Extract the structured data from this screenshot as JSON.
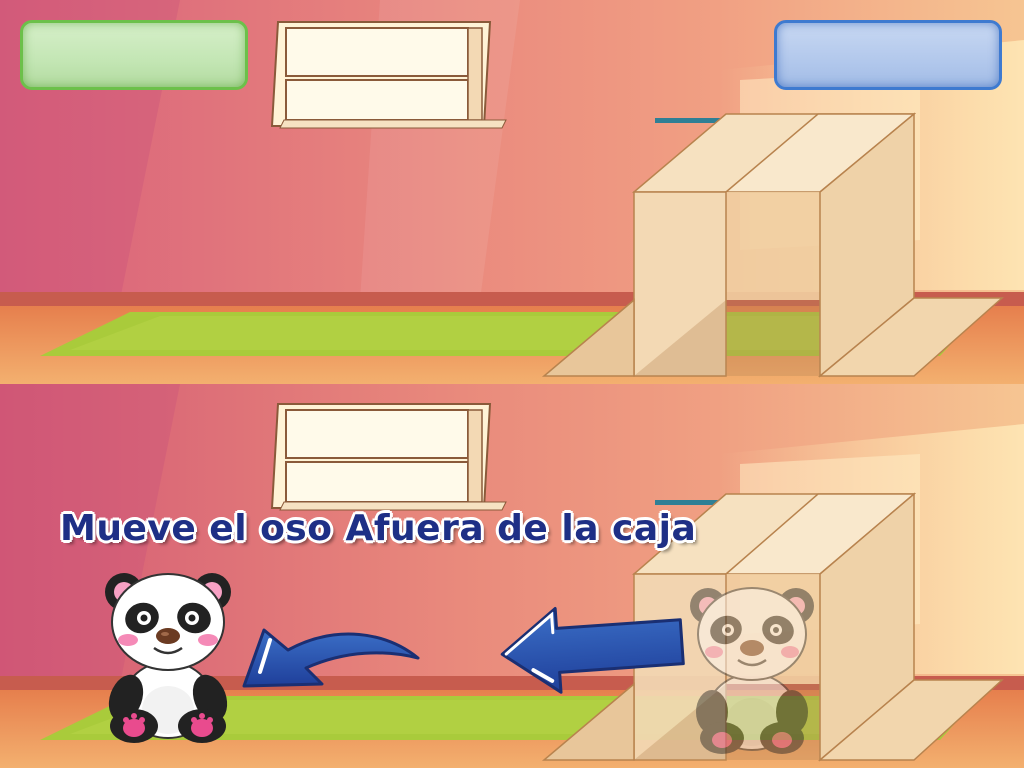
{
  "instruction": {
    "text": "Mueve el oso Afuera de la caja"
  },
  "scoreboxes": {
    "left_color": "#c3e6b4",
    "right_color": "#b2c8ec"
  },
  "scene": {
    "wall_color": "#e98a7a",
    "floor_color": "#efa463",
    "rug_color": "#a7c93a",
    "box_color": "#f3d9b4"
  },
  "icons": {
    "panda": "panda-icon",
    "ghost_panda": "panda-target-icon",
    "curved_arrow": "curved-arrow-left-icon",
    "straight_arrow": "arrow-left-icon"
  }
}
